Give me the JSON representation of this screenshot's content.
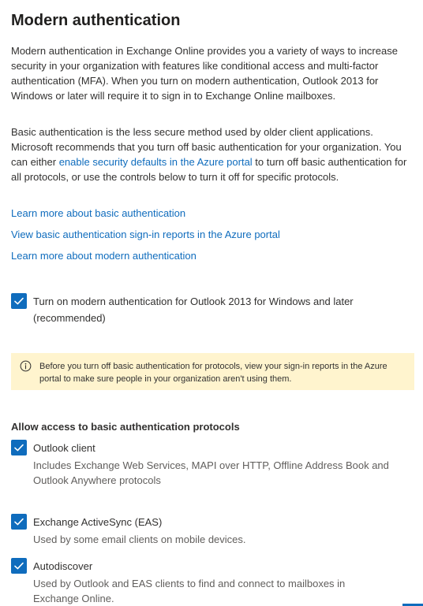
{
  "title": "Modern authentication",
  "intro": "Modern authentication in Exchange Online provides you a variety of ways to increase security in your organization with features like conditional access and multi-factor authentication (MFA). When you turn on modern authentication, Outlook 2013 for Windows or later will require it to sign in to Exchange Online mailboxes.",
  "basic_auth": {
    "text_before": "Basic authentication is the less secure method used by older client applications. Microsoft recommends that you turn off basic authentication for your organization. You can either ",
    "link": "enable security defaults in the Azure portal",
    "text_after": " to turn off basic authentication for all protocols, or use the controls below to turn it off for specific protocols."
  },
  "links": [
    "Learn more about basic authentication",
    "View basic authentication sign-in reports in the Azure portal",
    "Learn more about modern authentication"
  ],
  "modern_auth_checkbox": {
    "label": "Turn on modern authentication for Outlook 2013 for Windows and later (recommended)",
    "checked": true
  },
  "warning": {
    "icon": "info-icon",
    "text": "Before you turn off basic authentication for protocols, view your sign-in reports in the Azure portal to make sure people in your organization aren't using them."
  },
  "protocols_section": {
    "title": "Allow access to basic authentication protocols",
    "items": [
      {
        "label": "Outlook client",
        "description": "Includes Exchange Web Services, MAPI over HTTP, Offline Address Book and Outlook Anywhere protocols",
        "checked": true
      },
      {
        "label": "Exchange ActiveSync (EAS)",
        "description": "Used by some email clients on mobile devices.",
        "checked": true
      },
      {
        "label": "Autodiscover",
        "description": "Used by Outlook and EAS clients to find and connect to mailboxes in Exchange Online.",
        "checked": true
      }
    ]
  },
  "colors": {
    "accent": "#0f6cbd",
    "warning_bg": "#fff4ce",
    "text": "#323130",
    "secondary_text": "#605e5c"
  }
}
